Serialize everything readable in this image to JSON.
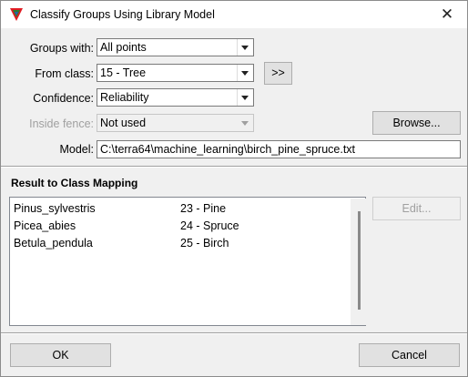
{
  "window": {
    "title": "Classify Groups Using Library Model",
    "close_glyph": "✕"
  },
  "form": {
    "groups_label": "Groups with:",
    "groups_value": "All points",
    "from_class_label": "From class:",
    "from_class_value": "15 - Tree",
    "expand_button": ">>",
    "confidence_label": "Confidence:",
    "confidence_value": "Reliability",
    "inside_fence_label": "Inside fence:",
    "inside_fence_value": "Not used",
    "browse_button": "Browse...",
    "model_label": "Model:",
    "model_value": "C:\\terra64\\machine_learning\\birch_pine_spruce.txt"
  },
  "mapping": {
    "title": "Result to Class Mapping",
    "edit_button": "Edit...",
    "rows": [
      {
        "result": "Pinus_sylvestris",
        "class": "23 - Pine"
      },
      {
        "result": "Picea_abies",
        "class": "24 - Spruce"
      },
      {
        "result": "Betula_pendula",
        "class": "25 - Birch"
      }
    ]
  },
  "footer": {
    "ok_button": "OK",
    "cancel_button": "Cancel"
  },
  "icons": {
    "app": "terrasolid-triangle-icon",
    "close": "close-icon",
    "dropdown": "chevron-down-icon"
  }
}
